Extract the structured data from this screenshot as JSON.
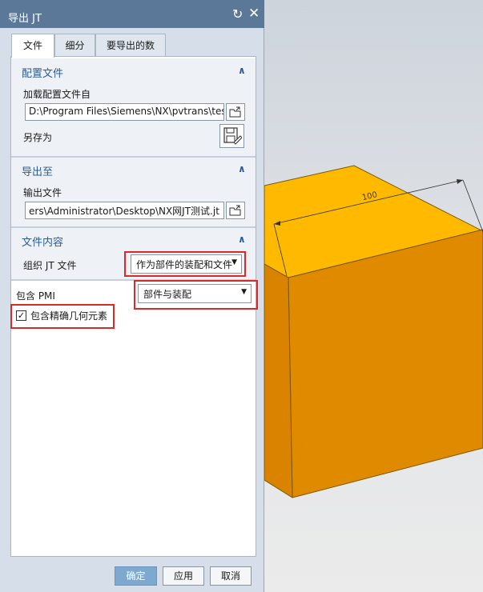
{
  "window": {
    "title": "导出 JT",
    "reset_icon": "reset-icon",
    "close_icon": "close-icon"
  },
  "tabs": [
    {
      "label": "文件",
      "active": true
    },
    {
      "label": "细分",
      "active": false
    },
    {
      "label": "要导出的数据",
      "active": false
    }
  ],
  "config_group": {
    "title": "配置文件",
    "load_label": "加载配置文件自",
    "load_path": "D:\\Program Files\\Siemens\\NX\\pvtrans\\tess",
    "save_as_label": "另存为"
  },
  "export_group": {
    "title": "导出至",
    "output_label": "输出文件",
    "output_path": "ers\\Administrator\\Desktop\\NX网JT测试.jt"
  },
  "content_group": {
    "title": "文件内容",
    "organize_label": "组织 JT 文件",
    "organize_value": "作为部件的装配和文件"
  },
  "pmi": {
    "label": "包含 PMI",
    "value": "部件与装配"
  },
  "precise_geometry": {
    "label": "包含精确几何元素",
    "checked": true
  },
  "buttons": {
    "ok": "确定",
    "apply": "应用",
    "cancel": "取消"
  },
  "model": {
    "dimension_label": "100",
    "top_color": "#ffba00",
    "front_color": "#e08a00"
  },
  "colors": {
    "title_bar": "#5c7898",
    "group_title": "#2e5c90",
    "highlight": "#d52b2b"
  }
}
